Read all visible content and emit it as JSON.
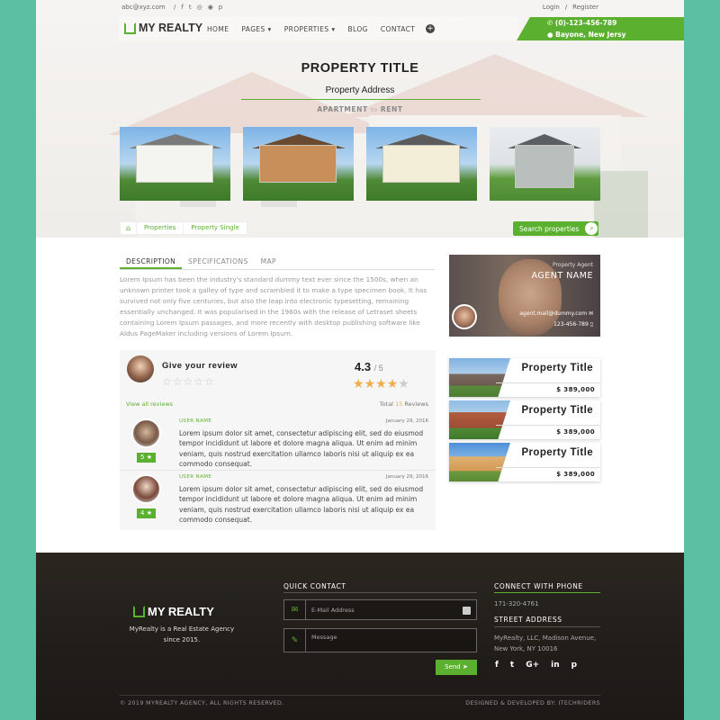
{
  "topbar": {
    "email": "abc@xyz.com",
    "social_icons": [
      "facebook-icon",
      "twitter-icon",
      "instagram-icon",
      "dribbble-icon",
      "pinterest-icon"
    ],
    "social_glyphs": [
      "f",
      "t",
      "◎",
      "◉",
      "p"
    ],
    "login": "Login",
    "separator": "/",
    "register": "Register"
  },
  "nav": {
    "logo": "MY REALTY",
    "items": [
      "HOME",
      "PAGES",
      "PROPERTIES",
      "BLOG",
      "CONTACT"
    ],
    "dropdown_items": [
      "PAGES",
      "PROPERTIES"
    ],
    "phone": "(0)-123-456-789",
    "location": "Bayone, New Jersy"
  },
  "hero": {
    "title": "PROPERTY TITLE",
    "address": "Property Address",
    "type_left": "APARTMENT",
    "type_mid": "to",
    "type_right": "RENT"
  },
  "breadcrumb": [
    "Properties",
    "Property Single"
  ],
  "search_button": "Search properties",
  "tabs": [
    "DESCRIPTION",
    "SPECIFICATIONS",
    "MAP"
  ],
  "description": "Lorem Ipsum has been the industry's standard dummy text ever since the 1500s, when an unknown printer took a galley of type and scrambled it to make a type specimen book. It has survived not only five centuries, but also the leap into electronic typesetting, remaining essentially unchanged. It was popularised in the 1960s with the release of Letraset sheets containing Lorem Ipsum passages, and more recently with desktop publishing software like Aldus PageMaker including versions of Lorem Ipsum.",
  "agent": {
    "label": "Property Agent",
    "name": "AGENT NAME",
    "email": "agent.mail@dummy.com",
    "phone": "123-456-789"
  },
  "reviews": {
    "give_title": "Give your review",
    "score": "4.3",
    "score_of": "/ 5",
    "stars_filled": 4,
    "stars_total": 5,
    "view_all": "View all reviews",
    "total_label": "Total",
    "total_count": "15",
    "total_suffix": "Reviews",
    "items": [
      {
        "user": "USER NAME",
        "date": "January 29, 2016",
        "rating": "5",
        "text": "Lorem ipsum dolor sit amet, consectetur adipiscing elit, sed do eiusmod tempor incididunt ut labore et dolore magna aliqua. Ut enim ad minim veniam, quis nostrud exercitation ullamco laboris nisi ut aliquip ex ea commodo consequat."
      },
      {
        "user": "USER NAME",
        "date": "January 29, 2016",
        "rating": "4",
        "text": "Lorem ipsum dolor sit amet, consectetur adipiscing elit, sed do eiusmod tempor incididunt ut labore et dolore magna aliqua. Ut enim ad minim veniam, quis nostrud exercitation ullamco laboris nisi ut aliquip ex ea commodo consequat."
      }
    ]
  },
  "properties": [
    {
      "title": "Property Title",
      "price": "$ 389,000"
    },
    {
      "title": "Property Title",
      "price": "$ 389,000"
    },
    {
      "title": "Property Title",
      "price": "$ 389,000"
    }
  ],
  "footer": {
    "logo": "MY REALTY",
    "tagline": "MyRealty is a Real Estate Agency since 2015.",
    "quick_contact": "QUICK CONTACT",
    "email_placeholder": "E-Mail Address",
    "message_placeholder": "Message",
    "send": "Send",
    "connect_title": "CONNECT WITH PHONE",
    "connect_phone": "171-320-4761",
    "street_title": "STREET ADDRESS",
    "street_address": "MyRealty, LLC, Madison Avenue, New York, NY 10016",
    "social_icons": [
      "facebook-icon",
      "twitter-icon",
      "google-plus-icon",
      "linkedin-icon",
      "pinterest-icon"
    ],
    "social_glyphs": [
      "f",
      "t",
      "G+",
      "in",
      "p"
    ],
    "copyright": "© 2019 MYREALTY AGENCY, ALL RIGHTS RESERVED.",
    "designed": "DESIGNED & DEVELOPED BY: ITECHRIDERS"
  },
  "colors": {
    "accent": "#5cb030",
    "background": "#5bbfa1",
    "footer": "#221e1a",
    "star": "#f0ad4e"
  }
}
